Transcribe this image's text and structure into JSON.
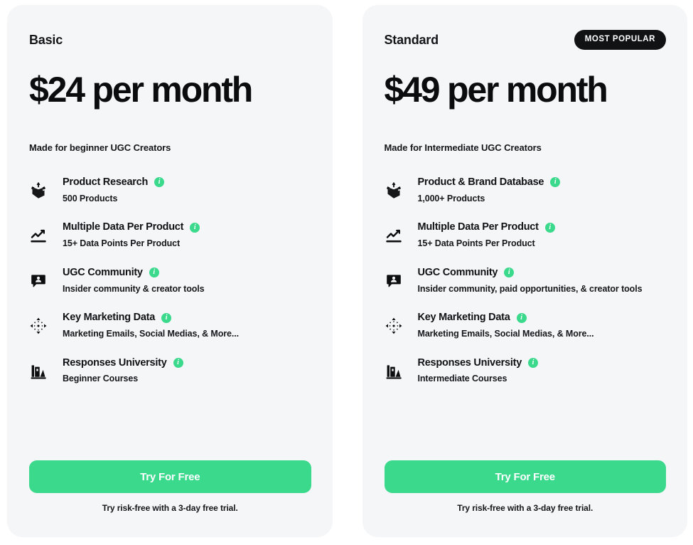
{
  "accent_color": "#3ad98c",
  "card_background": "#f5f6f8",
  "badge_color": "#111214",
  "plans": [
    {
      "name": "Basic",
      "price": "$24 per month",
      "tagline": "Made for beginner UGC Creators",
      "badge": "",
      "cta_label": "Try For Free",
      "cta_note": "Try risk-free with a 3-day free trial.",
      "features": [
        {
          "icon": "package-box-icon",
          "title": "Product Research",
          "subtitle": "500 Products",
          "info": "i"
        },
        {
          "icon": "line-chart-icon",
          "title": "Multiple Data Per Product",
          "subtitle": "15+ Data Points Per Product",
          "info": "i"
        },
        {
          "icon": "chat-person-icon",
          "title": "UGC Community",
          "subtitle": "Insider community & creator tools",
          "info": "i"
        },
        {
          "icon": "four-arrows-icon",
          "title": "Key Marketing Data",
          "subtitle": "Marketing Emails, Social Medias, & More...",
          "info": "i"
        },
        {
          "icon": "university-building-icon",
          "title": "Responses University",
          "subtitle": "Beginner Courses",
          "info": "i"
        }
      ]
    },
    {
      "name": "Standard",
      "price": "$49 per month",
      "tagline": "Made for Intermediate UGC Creators",
      "badge": "MOST POPULAR",
      "cta_label": "Try For Free",
      "cta_note": "Try risk-free with a 3-day free trial.",
      "features": [
        {
          "icon": "package-box-icon",
          "title": "Product & Brand Database",
          "subtitle": "1,000+ Products",
          "info": "i"
        },
        {
          "icon": "line-chart-icon",
          "title": "Multiple Data Per Product",
          "subtitle": "15+ Data Points Per Product",
          "info": "i"
        },
        {
          "icon": "chat-person-icon",
          "title": "UGC Community",
          "subtitle": "Insider community, paid opportunities, & creator tools",
          "info": "i"
        },
        {
          "icon": "four-arrows-icon",
          "title": "Key Marketing Data",
          "subtitle": "Marketing Emails, Social Medias, & More...",
          "info": "i"
        },
        {
          "icon": "university-building-icon",
          "title": "Responses University",
          "subtitle": "Intermediate Courses",
          "info": "i"
        }
      ]
    }
  ]
}
